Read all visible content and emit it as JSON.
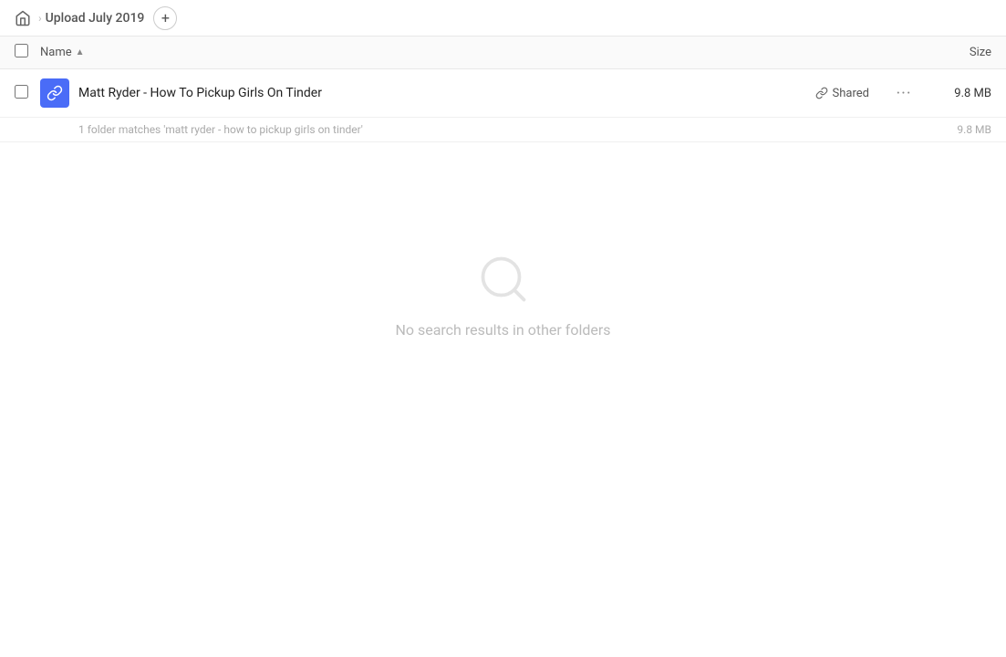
{
  "header": {
    "home_icon": "home",
    "breadcrumb_title": "Upload July 2019",
    "add_button_label": "+"
  },
  "columns": {
    "name_label": "Name",
    "size_label": "Size",
    "sort_direction": "asc"
  },
  "file_row": {
    "name": "Matt Ryder - How To Pickup Girls On Tinder",
    "shared_label": "Shared",
    "more_icon": "•••",
    "size": "9.8 MB",
    "link_icon": "🔗"
  },
  "match_info": {
    "text": "1 folder matches 'matt ryder - how to pickup girls on tinder'",
    "size": "9.8 MB"
  },
  "empty_state": {
    "icon": "search",
    "message": "No search results in other folders"
  }
}
